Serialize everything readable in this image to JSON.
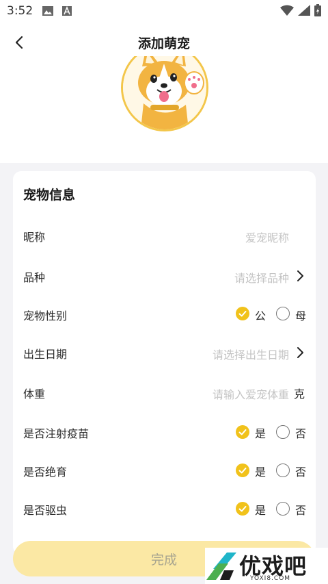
{
  "status_bar": {
    "time": "3:52",
    "icons": [
      "image-icon",
      "a-notification-icon",
      "wifi-icon",
      "signal-icon",
      "battery-icon"
    ]
  },
  "header": {
    "title": "添加萌宠"
  },
  "pet_info": {
    "section_title": "宠物信息",
    "rows": {
      "nickname": {
        "label": "昵称",
        "placeholder": "爱宠昵称"
      },
      "breed": {
        "label": "品种",
        "placeholder": "请选择品种"
      },
      "gender": {
        "label": "宠物性别",
        "option_yes": "公",
        "option_no": "母",
        "selected": "公"
      },
      "birthday": {
        "label": "出生日期",
        "placeholder": "请选择出生日期"
      },
      "weight": {
        "label": "体重",
        "placeholder": "请输入爱宠体重",
        "unit": "克"
      },
      "vaccinated": {
        "label": "是否注射疫苗",
        "option_yes": "是",
        "option_no": "否",
        "selected": "是"
      },
      "sterilized": {
        "label": "是否绝育",
        "option_yes": "是",
        "option_no": "否",
        "selected": "是"
      },
      "dewormed": {
        "label": "是否驱虫",
        "option_yes": "是",
        "option_no": "否",
        "selected": "是"
      }
    }
  },
  "footer": {
    "done_label": "完成"
  },
  "watermark": {
    "brand": "优戏吧",
    "domain": "YOXI8.COM"
  },
  "colors": {
    "accent": "#f1c21b",
    "button_bg": "#fbe8a4",
    "page_bg": "#f3f3f6"
  }
}
